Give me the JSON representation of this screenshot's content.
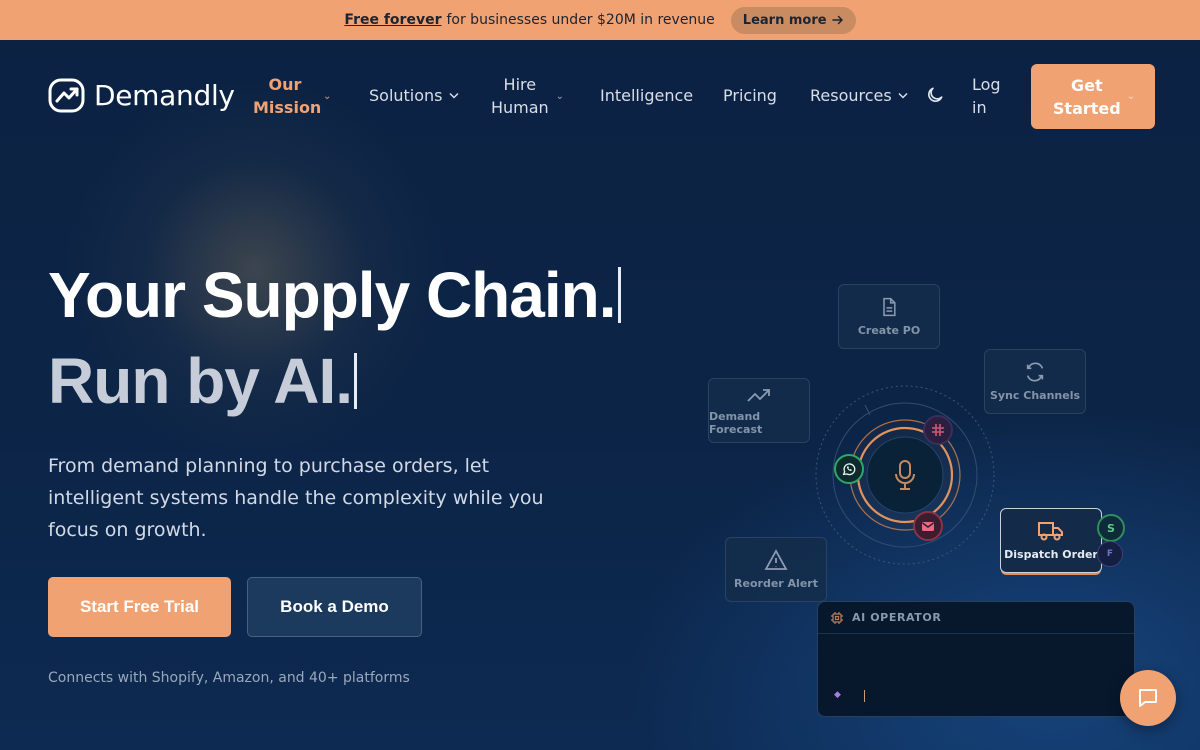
{
  "announcement": {
    "highlight": "Free forever",
    "text": "for businesses under $20M in revenue",
    "cta_label": "Learn more"
  },
  "nav": {
    "logo_text": "Demandly",
    "items": [
      {
        "label": "Our Mission",
        "active": true,
        "has_dropdown": true
      },
      {
        "label": "Solutions",
        "active": false,
        "has_dropdown": true
      },
      {
        "label": "Hire Human",
        "active": false,
        "has_dropdown": true
      },
      {
        "label": "Intelligence",
        "active": false,
        "has_dropdown": false
      },
      {
        "label": "Pricing",
        "active": false,
        "has_dropdown": false
      },
      {
        "label": "Resources",
        "active": false,
        "has_dropdown": true
      }
    ],
    "theme_icon": "moon-icon",
    "login_label": "Log in",
    "cta_label": "Get Started"
  },
  "hero": {
    "headline_line1": "Your Supply Chain.",
    "headline_line2": "Run by AI.",
    "subheading": "From demand planning to purchase orders, let intelligent systems handle the complexity while you focus on growth.",
    "primary_cta": "Start Free Trial",
    "secondary_cta": "Book a Demo",
    "integrations_note": "Connects with Shopify, Amazon, and 40+ platforms"
  },
  "illustration": {
    "cards": [
      {
        "label": "Create PO",
        "icon": "document-icon"
      },
      {
        "label": "Sync Channels",
        "icon": "refresh-icon"
      },
      {
        "label": "Demand Forecast",
        "icon": "trend-up-icon"
      },
      {
        "label": "Reorder Alert",
        "icon": "warning-icon"
      },
      {
        "label": "Dispatch Order",
        "icon": "truck-icon"
      }
    ],
    "hub_icon": "microphone-icon",
    "orbit_icons": [
      "whatsapp-icon",
      "slack-icon",
      "email-icon"
    ],
    "dispatch_badges": [
      "S",
      "F"
    ],
    "panel_title": "AI OPERATOR"
  },
  "colors": {
    "accent": "#f0a272",
    "background": "#0b2243",
    "announcement_bg": "#f0a272"
  }
}
